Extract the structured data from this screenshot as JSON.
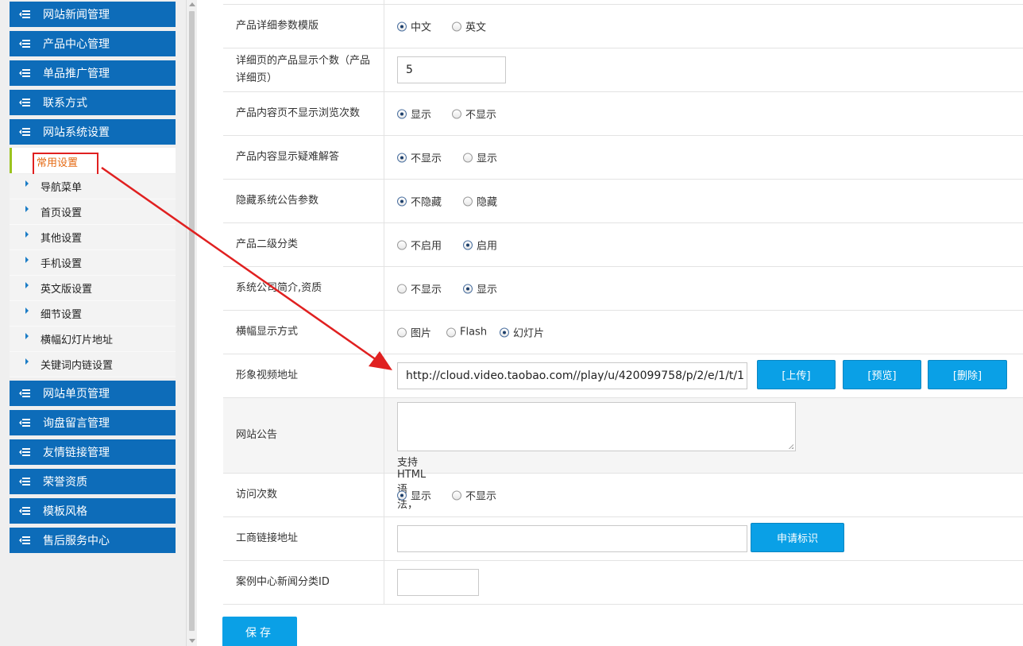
{
  "sidebar": {
    "menu_top": [
      {
        "label": "网站新闻管理"
      },
      {
        "label": "产品中心管理"
      },
      {
        "label": "单品推广管理"
      },
      {
        "label": "联系方式"
      },
      {
        "label": "网站系统设置"
      }
    ],
    "active_sub": "常用设置",
    "sub_items": [
      {
        "label": "导航菜单"
      },
      {
        "label": "首页设置"
      },
      {
        "label": "其他设置"
      },
      {
        "label": "手机设置"
      },
      {
        "label": "英文版设置"
      },
      {
        "label": "细节设置"
      },
      {
        "label": "横幅幻灯片地址"
      },
      {
        "label": "关键词内链设置"
      }
    ],
    "menu_bottom": [
      {
        "label": "网站单页管理"
      },
      {
        "label": "询盘留言管理"
      },
      {
        "label": "友情链接管理"
      },
      {
        "label": "荣誉资质"
      },
      {
        "label": "模板风格"
      },
      {
        "label": "售后服务中心"
      }
    ]
  },
  "form": {
    "rows": [
      {
        "label": "产品详细参数模版",
        "options": [
          {
            "text": "中文",
            "checked": true
          },
          {
            "text": "英文",
            "checked": false
          }
        ]
      },
      {
        "label": "详细页的产品显示个数（产品详细页）",
        "value": "5"
      },
      {
        "label": "产品内容页不显示浏览次数",
        "options": [
          {
            "text": "显示",
            "checked": true
          },
          {
            "text": "不显示",
            "checked": false
          }
        ]
      },
      {
        "label": "产品内容显示疑难解答",
        "options": [
          {
            "text": "不显示",
            "checked": true
          },
          {
            "text": "显示",
            "checked": false
          }
        ]
      },
      {
        "label": "隐藏系统公告参数",
        "options": [
          {
            "text": "不隐藏",
            "checked": true
          },
          {
            "text": "隐藏",
            "checked": false
          }
        ]
      },
      {
        "label": "产品二级分类",
        "options": [
          {
            "text": "不启用",
            "checked": false
          },
          {
            "text": "启用",
            "checked": true
          }
        ]
      },
      {
        "label": "系统公司简介,资质",
        "options": [
          {
            "text": "不显示",
            "checked": false
          },
          {
            "text": "显示",
            "checked": true
          }
        ]
      },
      {
        "label": "横幅显示方式",
        "options": [
          {
            "text": "图片",
            "checked": false
          },
          {
            "text": "Flash",
            "checked": false
          },
          {
            "text": "幻灯片",
            "checked": true
          }
        ]
      },
      {
        "label": "形象视频地址",
        "value": "http://cloud.video.taobao.com//play/u/420099758/p/2/e/1/t/1",
        "buttons": [
          "[上传]",
          "[预览]",
          "[删除]"
        ]
      },
      {
        "label": "网站公告",
        "hint": "支持HTML语法，"
      },
      {
        "label": "访问次数",
        "options": [
          {
            "text": "显示",
            "checked": true
          },
          {
            "text": "不显示",
            "checked": false
          }
        ]
      },
      {
        "label": "工商链接地址",
        "value": "",
        "button": "申请标识"
      },
      {
        "label": "案例中心新闻分类ID",
        "value": ""
      }
    ],
    "save_label": "保存",
    "accent": "#0aa0e6"
  },
  "colors": {
    "menu_bg": "#0d6cb9",
    "active_sub_text": "#e56a13",
    "annotation": "#e02020"
  }
}
